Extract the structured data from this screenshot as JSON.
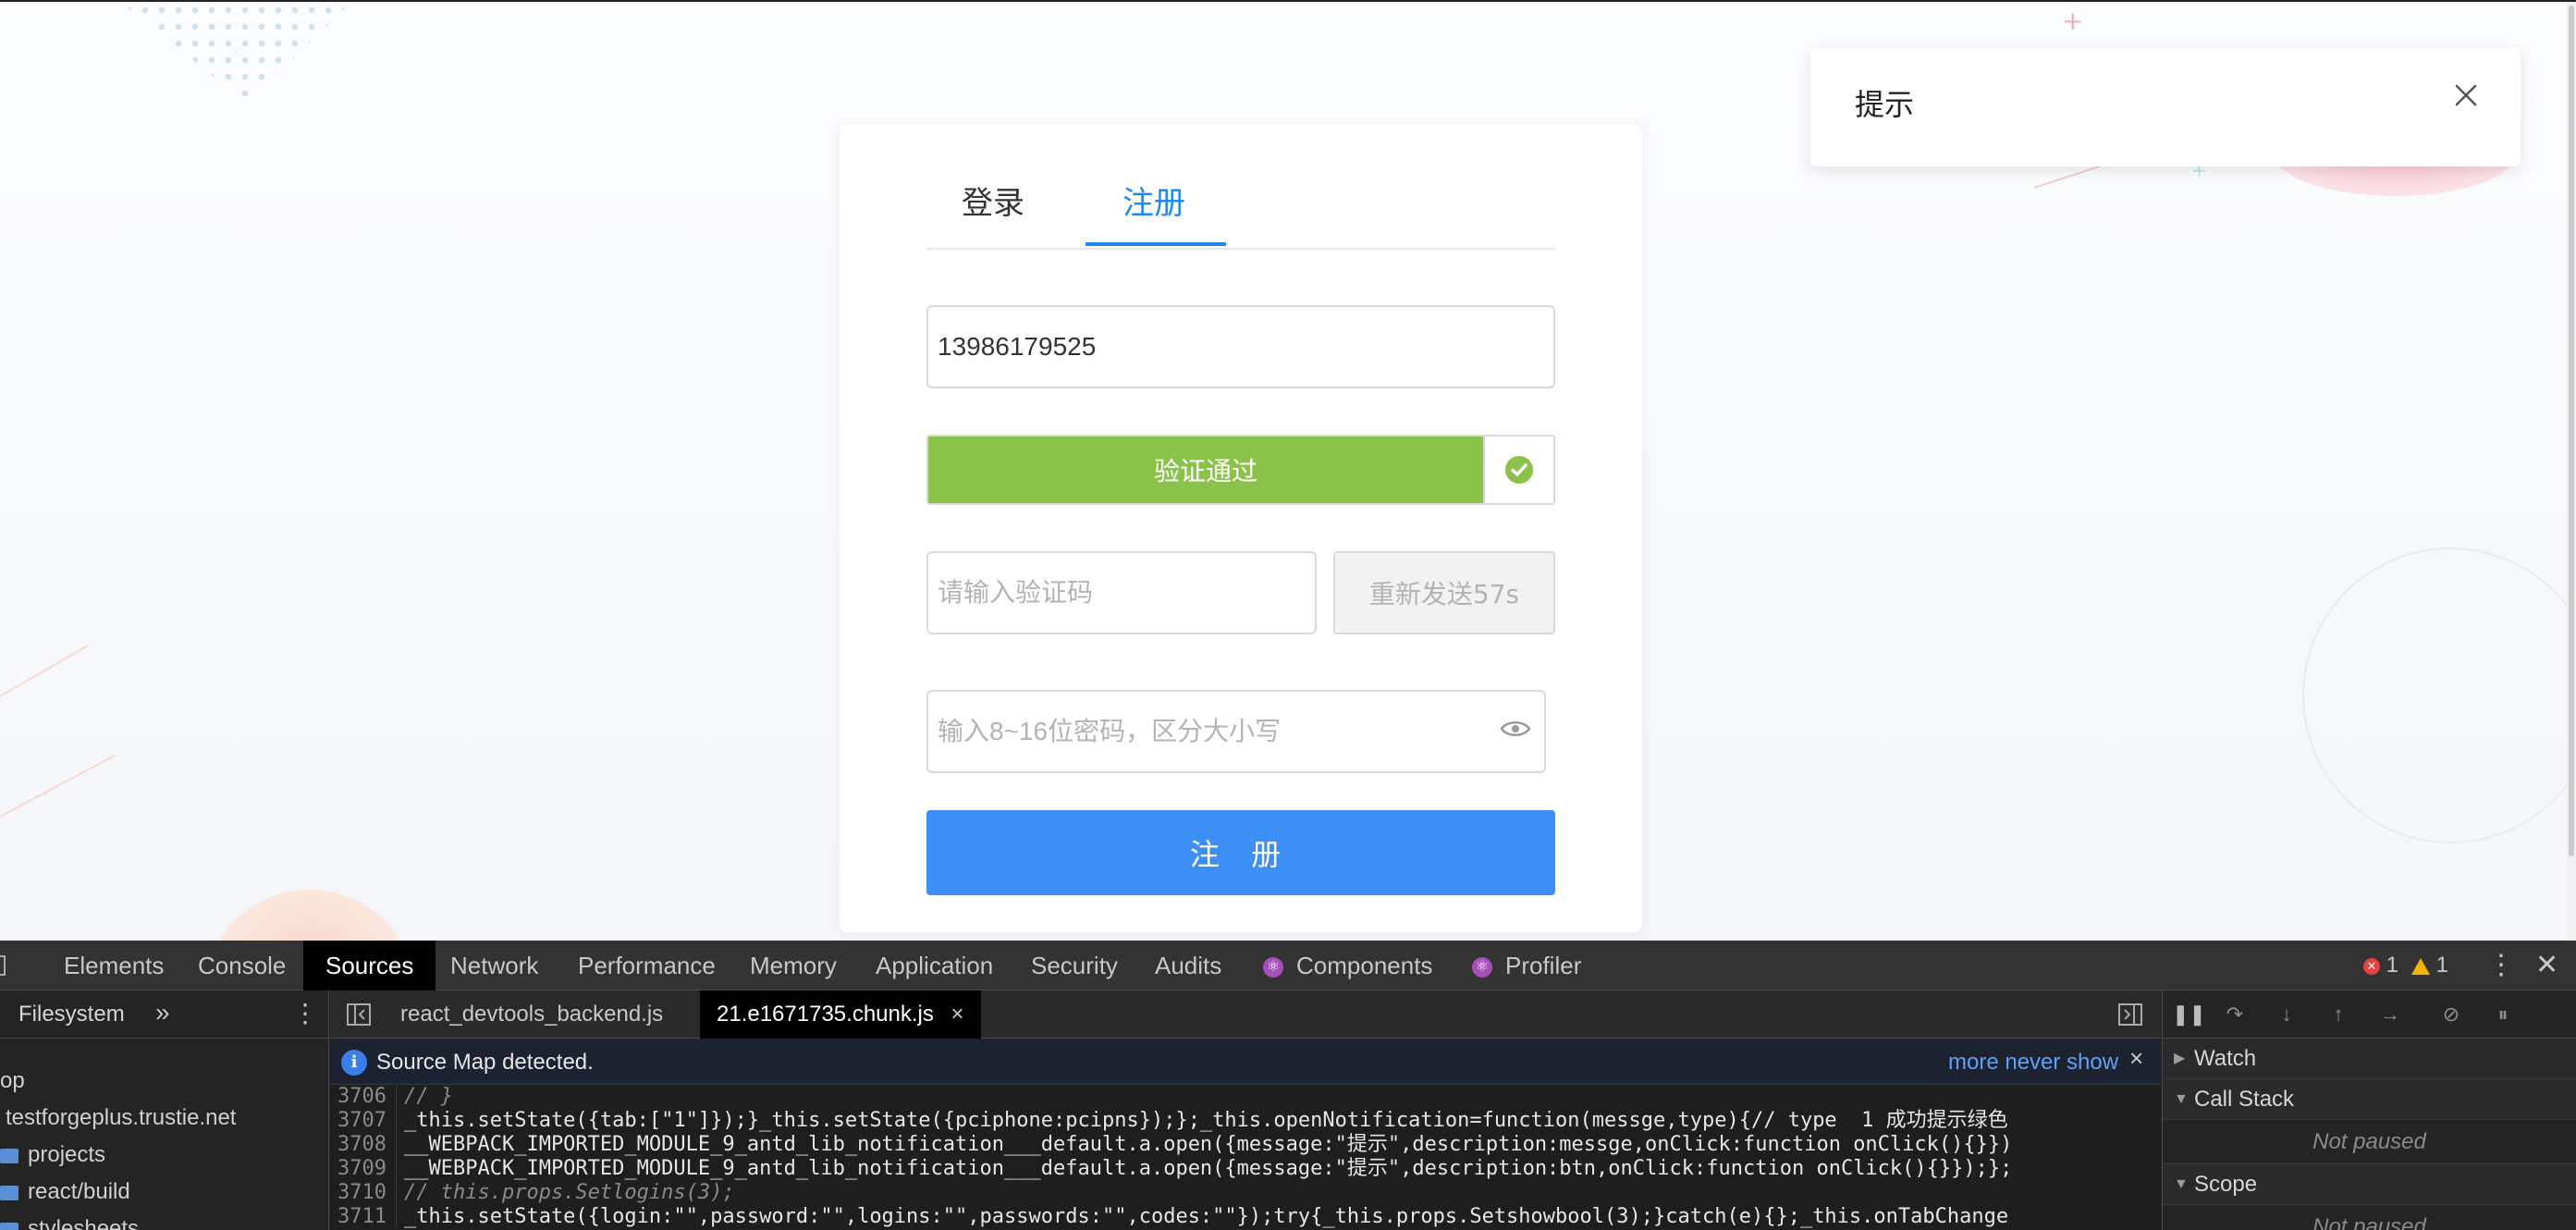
{
  "login_card": {
    "tabs": [
      {
        "label": "登录",
        "active": false
      },
      {
        "label": "注册",
        "active": true
      }
    ],
    "phone_input": {
      "value": "13986179525",
      "placeholder": ""
    },
    "slider_verify": {
      "label": "验证通过",
      "status": "passed"
    },
    "code_input": {
      "value": "",
      "placeholder": "请输入验证码"
    },
    "resend_button": {
      "label": "重新发送57s"
    },
    "password_input": {
      "value": "",
      "placeholder": "输入8~16位密码，区分大小写"
    },
    "submit_button": {
      "label": "注 册"
    }
  },
  "notification": {
    "title": "提示"
  },
  "colors": {
    "accent": "#1e88f5",
    "verify_green": "#8bc34a",
    "submit_blue": "#3d8ef5"
  },
  "devtools": {
    "tabs": [
      {
        "label": "Elements",
        "active": false
      },
      {
        "label": "Console",
        "active": false
      },
      {
        "label": "Sources",
        "active": true
      },
      {
        "label": "Network",
        "active": false
      },
      {
        "label": "Performance",
        "active": false
      },
      {
        "label": "Memory",
        "active": false
      },
      {
        "label": "Application",
        "active": false
      },
      {
        "label": "Security",
        "active": false
      },
      {
        "label": "Audits",
        "active": false
      },
      {
        "label": "Components",
        "active": false,
        "icon": "react-icon"
      },
      {
        "label": "Profiler",
        "active": false,
        "icon": "react-icon"
      }
    ],
    "error_count": "1",
    "warning_count": "1",
    "navigator": {
      "tab": "Filesystem",
      "rows": [
        {
          "label": "op",
          "type": "text"
        },
        {
          "label": "testforgeplus.trustie.net",
          "type": "text"
        },
        {
          "label": "projects",
          "type": "folder"
        },
        {
          "label": "react/build",
          "type": "folder"
        },
        {
          "label": "stylesheets",
          "type": "folder"
        }
      ]
    },
    "editor_tabs": [
      {
        "label": "react_devtools_backend.js",
        "active": false
      },
      {
        "label": "21.e1671735.chunk.js",
        "active": true
      }
    ],
    "banner": {
      "message": "Source Map detected.",
      "link": "more never show"
    },
    "code_lines": [
      {
        "num": "3706",
        "text": "// }",
        "comment": true
      },
      {
        "num": "3707",
        "text": "_this.setState({tab:[\"1\"]});}_this.setState({pciphone:pcipns});};_this.openNotification=function(messge,type){// type  1 成功提示绿色",
        "comment": false
      },
      {
        "num": "3708",
        "text": "__WEBPACK_IMPORTED_MODULE_9_antd_lib_notification___default.a.open({message:\"提示\",description:messge,onClick:function onClick(){}})",
        "comment": false
      },
      {
        "num": "3709",
        "text": "__WEBPACK_IMPORTED_MODULE_9_antd_lib_notification___default.a.open({message:\"提示\",description:btn,onClick:function onClick(){}});};",
        "comment": false
      },
      {
        "num": "3710",
        "text": "// this.props.Setlogins(3);",
        "comment": true
      },
      {
        "num": "3711",
        "text": "_this.setState({login:\"\",password:\"\",logins:\"\",passwords:\"\",codes:\"\"});try{_this.props.Setshowbool(3);}catch(e){};_this.onTabChange",
        "comment": false
      }
    ],
    "debugger": {
      "watch": "Watch",
      "call_stack": "Call Stack",
      "call_stack_status": "Not paused",
      "scope": "Scope",
      "scope_status": "Not paused"
    }
  }
}
